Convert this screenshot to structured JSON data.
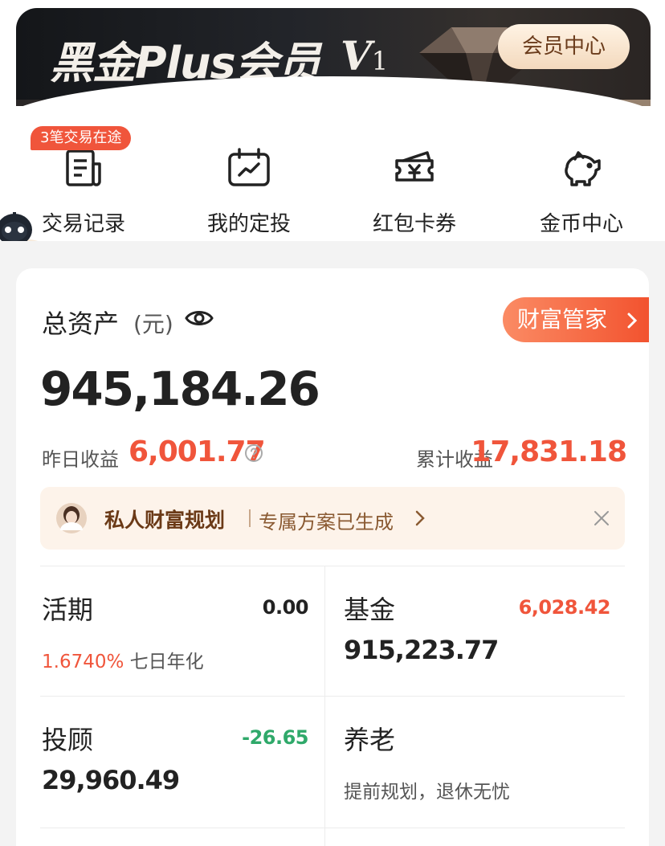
{
  "vip_banner": {
    "title": "黑金Plus会员",
    "level_letter": "V",
    "level_number": "1",
    "center_button": "会员中心"
  },
  "quick_entries": {
    "badge": "3笔交易在途",
    "items": [
      {
        "label": "交易记录",
        "icon": "receipt-icon"
      },
      {
        "label": "我的定投",
        "icon": "calendar-chart-icon"
      },
      {
        "label": "红包卡券",
        "icon": "coupon-yen-icon"
      },
      {
        "label": "金币中心",
        "icon": "piggy-bank-icon"
      }
    ]
  },
  "asset": {
    "title": "总资产",
    "unit": "(元)",
    "wealth_manager_button": "财富管家",
    "total": "945,184.26",
    "yesterday_label": "昨日收益",
    "yesterday_value": "6,001.77",
    "cumulative_label": "累计收益",
    "cumulative_value": "17,831.18"
  },
  "plan_bar": {
    "title": "私人财富规划",
    "text": "专属方案已生成"
  },
  "products": {
    "current": {
      "name": "活期",
      "amount": "0.00",
      "rate": "1.6740%",
      "rate_label": "七日年化"
    },
    "fund": {
      "name": "基金",
      "profit": "6,028.42",
      "amount": "915,223.77"
    },
    "advisory": {
      "name": "投顾",
      "profit": "-26.65",
      "amount": "29,960.49"
    },
    "pension": {
      "name": "养老",
      "subtitle": "提前规划，退休无忧"
    }
  },
  "colors": {
    "accent_red": "#f0553b",
    "profit_green": "#2fa96a",
    "plan_brown": "#6b3a17"
  }
}
